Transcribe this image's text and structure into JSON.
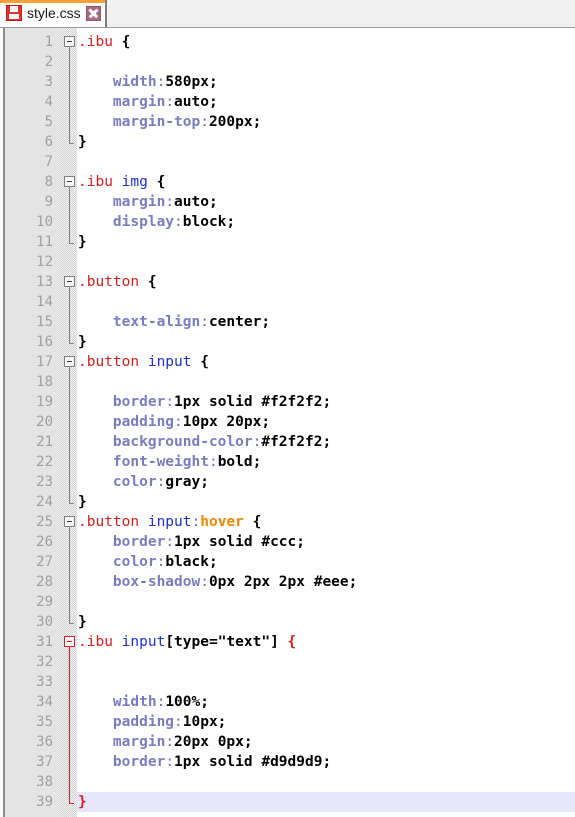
{
  "tab": {
    "title": "style.css",
    "save_icon": "floppy-disk-icon",
    "close_icon": "close-icon",
    "accent_color": "#f7a035"
  },
  "editor": {
    "language": "css",
    "total_lines": 39,
    "current_line": 39,
    "active_fold_line": 31,
    "current_line_highlight": "#e6e6fa",
    "gutter_bg": "#e4e4e4",
    "line_number_color": "#a0a0a0"
  },
  "theme": {
    "selector_class": "#e01b1b",
    "selector_element": "#1b2fe0",
    "pseudo_class": "#f28500",
    "property": "#7b7bc4",
    "value": "#000000",
    "punctuation": "#7b68b8"
  },
  "lines": [
    {
      "n": 1,
      "fold": "open",
      "tokens": [
        {
          "c": "t-sel",
          "s": ".ibu"
        },
        {
          "c": "t-brace",
          "s": " {"
        }
      ]
    },
    {
      "n": 2,
      "fold": "bar",
      "tokens": []
    },
    {
      "n": 3,
      "fold": "bar",
      "tokens": [
        {
          "c": "t-prop",
          "s": "    width"
        },
        {
          "c": "t-colon",
          "s": ":"
        },
        {
          "c": "t-val",
          "s": "580px;"
        }
      ]
    },
    {
      "n": 4,
      "fold": "bar",
      "tokens": [
        {
          "c": "t-prop",
          "s": "    margin"
        },
        {
          "c": "t-colon",
          "s": ":"
        },
        {
          "c": "t-val",
          "s": "auto;"
        }
      ]
    },
    {
      "n": 5,
      "fold": "bar",
      "tokens": [
        {
          "c": "t-prop",
          "s": "    margin-top"
        },
        {
          "c": "t-colon",
          "s": ":"
        },
        {
          "c": "t-val",
          "s": "200px;"
        }
      ]
    },
    {
      "n": 6,
      "fold": "end",
      "tokens": [
        {
          "c": "t-brace",
          "s": "}"
        }
      ]
    },
    {
      "n": 7,
      "fold": "none",
      "tokens": []
    },
    {
      "n": 8,
      "fold": "open",
      "tokens": [
        {
          "c": "t-sel",
          "s": ".ibu"
        },
        {
          "c": "t-brace",
          "s": " "
        },
        {
          "c": "t-el",
          "s": "img"
        },
        {
          "c": "t-brace",
          "s": " {"
        }
      ]
    },
    {
      "n": 9,
      "fold": "bar",
      "tokens": [
        {
          "c": "t-prop",
          "s": "    margin"
        },
        {
          "c": "t-colon",
          "s": ":"
        },
        {
          "c": "t-val",
          "s": "auto;"
        }
      ]
    },
    {
      "n": 10,
      "fold": "bar",
      "tokens": [
        {
          "c": "t-prop",
          "s": "    display"
        },
        {
          "c": "t-colon",
          "s": ":"
        },
        {
          "c": "t-val",
          "s": "block;"
        }
      ]
    },
    {
      "n": 11,
      "fold": "end",
      "tokens": [
        {
          "c": "t-brace",
          "s": "}"
        }
      ]
    },
    {
      "n": 12,
      "fold": "none",
      "tokens": []
    },
    {
      "n": 13,
      "fold": "open",
      "tokens": [
        {
          "c": "t-sel",
          "s": ".button"
        },
        {
          "c": "t-brace",
          "s": " {"
        }
      ]
    },
    {
      "n": 14,
      "fold": "bar",
      "tokens": []
    },
    {
      "n": 15,
      "fold": "bar",
      "tokens": [
        {
          "c": "t-prop",
          "s": "    text-align"
        },
        {
          "c": "t-colon",
          "s": ":"
        },
        {
          "c": "t-val",
          "s": "center;"
        }
      ]
    },
    {
      "n": 16,
      "fold": "end",
      "tokens": [
        {
          "c": "t-brace",
          "s": "}"
        }
      ]
    },
    {
      "n": 17,
      "fold": "open",
      "tokens": [
        {
          "c": "t-sel",
          "s": ".button"
        },
        {
          "c": "t-brace",
          "s": " "
        },
        {
          "c": "t-el",
          "s": "input"
        },
        {
          "c": "t-brace",
          "s": " {"
        }
      ]
    },
    {
      "n": 18,
      "fold": "bar",
      "tokens": []
    },
    {
      "n": 19,
      "fold": "bar",
      "tokens": [
        {
          "c": "t-prop",
          "s": "    border"
        },
        {
          "c": "t-colon",
          "s": ":"
        },
        {
          "c": "t-val",
          "s": "1px solid #f2f2f2;"
        }
      ]
    },
    {
      "n": 20,
      "fold": "bar",
      "tokens": [
        {
          "c": "t-prop",
          "s": "    padding"
        },
        {
          "c": "t-colon",
          "s": ":"
        },
        {
          "c": "t-val",
          "s": "10px 20px;"
        }
      ]
    },
    {
      "n": 21,
      "fold": "bar",
      "tokens": [
        {
          "c": "t-prop",
          "s": "    background-color"
        },
        {
          "c": "t-colon",
          "s": ":"
        },
        {
          "c": "t-val",
          "s": "#f2f2f2;"
        }
      ]
    },
    {
      "n": 22,
      "fold": "bar",
      "tokens": [
        {
          "c": "t-prop",
          "s": "    font-weight"
        },
        {
          "c": "t-colon",
          "s": ":"
        },
        {
          "c": "t-val",
          "s": "bold;"
        }
      ]
    },
    {
      "n": 23,
      "fold": "bar",
      "tokens": [
        {
          "c": "t-prop",
          "s": "    color"
        },
        {
          "c": "t-colon",
          "s": ":"
        },
        {
          "c": "t-val",
          "s": "gray;"
        }
      ]
    },
    {
      "n": 24,
      "fold": "end",
      "tokens": [
        {
          "c": "t-brace",
          "s": "}"
        }
      ]
    },
    {
      "n": 25,
      "fold": "open",
      "tokens": [
        {
          "c": "t-sel",
          "s": ".button"
        },
        {
          "c": "t-brace",
          "s": " "
        },
        {
          "c": "t-el",
          "s": "input"
        },
        {
          "c": "t-colon",
          "s": ":"
        },
        {
          "c": "t-pseudo",
          "s": "hover"
        },
        {
          "c": "t-brace",
          "s": " {"
        }
      ]
    },
    {
      "n": 26,
      "fold": "bar",
      "tokens": [
        {
          "c": "t-prop",
          "s": "    border"
        },
        {
          "c": "t-colon",
          "s": ":"
        },
        {
          "c": "t-val",
          "s": "1px solid #ccc;"
        }
      ]
    },
    {
      "n": 27,
      "fold": "bar",
      "tokens": [
        {
          "c": "t-prop",
          "s": "    color"
        },
        {
          "c": "t-colon",
          "s": ":"
        },
        {
          "c": "t-val",
          "s": "black;"
        }
      ]
    },
    {
      "n": 28,
      "fold": "bar",
      "tokens": [
        {
          "c": "t-prop",
          "s": "    box-shadow"
        },
        {
          "c": "t-colon",
          "s": ":"
        },
        {
          "c": "t-val",
          "s": "0px 2px 2px #eee;"
        }
      ]
    },
    {
      "n": 29,
      "fold": "bar",
      "tokens": []
    },
    {
      "n": 30,
      "fold": "end",
      "tokens": [
        {
          "c": "t-brace",
          "s": "}"
        }
      ]
    },
    {
      "n": 31,
      "fold": "open-active",
      "tokens": [
        {
          "c": "t-sel",
          "s": ".ibu"
        },
        {
          "c": "t-brace",
          "s": " "
        },
        {
          "c": "t-el",
          "s": "input"
        },
        {
          "c": "t-attr",
          "s": "[type=\"text\"]"
        },
        {
          "c": "t-brace-a",
          "s": " {"
        }
      ]
    },
    {
      "n": 32,
      "fold": "bar-active",
      "tokens": []
    },
    {
      "n": 33,
      "fold": "bar-active",
      "tokens": []
    },
    {
      "n": 34,
      "fold": "bar-active",
      "tokens": [
        {
          "c": "t-prop",
          "s": "    width"
        },
        {
          "c": "t-colon",
          "s": ":"
        },
        {
          "c": "t-val",
          "s": "100%;"
        }
      ]
    },
    {
      "n": 35,
      "fold": "bar-active",
      "tokens": [
        {
          "c": "t-prop",
          "s": "    padding"
        },
        {
          "c": "t-colon",
          "s": ":"
        },
        {
          "c": "t-val",
          "s": "10px;"
        }
      ]
    },
    {
      "n": 36,
      "fold": "bar-active",
      "tokens": [
        {
          "c": "t-prop",
          "s": "    margin"
        },
        {
          "c": "t-colon",
          "s": ":"
        },
        {
          "c": "t-val",
          "s": "20px 0px;"
        }
      ]
    },
    {
      "n": 37,
      "fold": "bar-active",
      "tokens": [
        {
          "c": "t-prop",
          "s": "    border"
        },
        {
          "c": "t-colon",
          "s": ":"
        },
        {
          "c": "t-val",
          "s": "1px solid #d9d9d9;"
        }
      ]
    },
    {
      "n": 38,
      "fold": "bar-active",
      "tokens": []
    },
    {
      "n": 39,
      "fold": "end-active",
      "current": true,
      "tokens": [
        {
          "c": "t-brace-a",
          "s": "}"
        }
      ]
    }
  ]
}
